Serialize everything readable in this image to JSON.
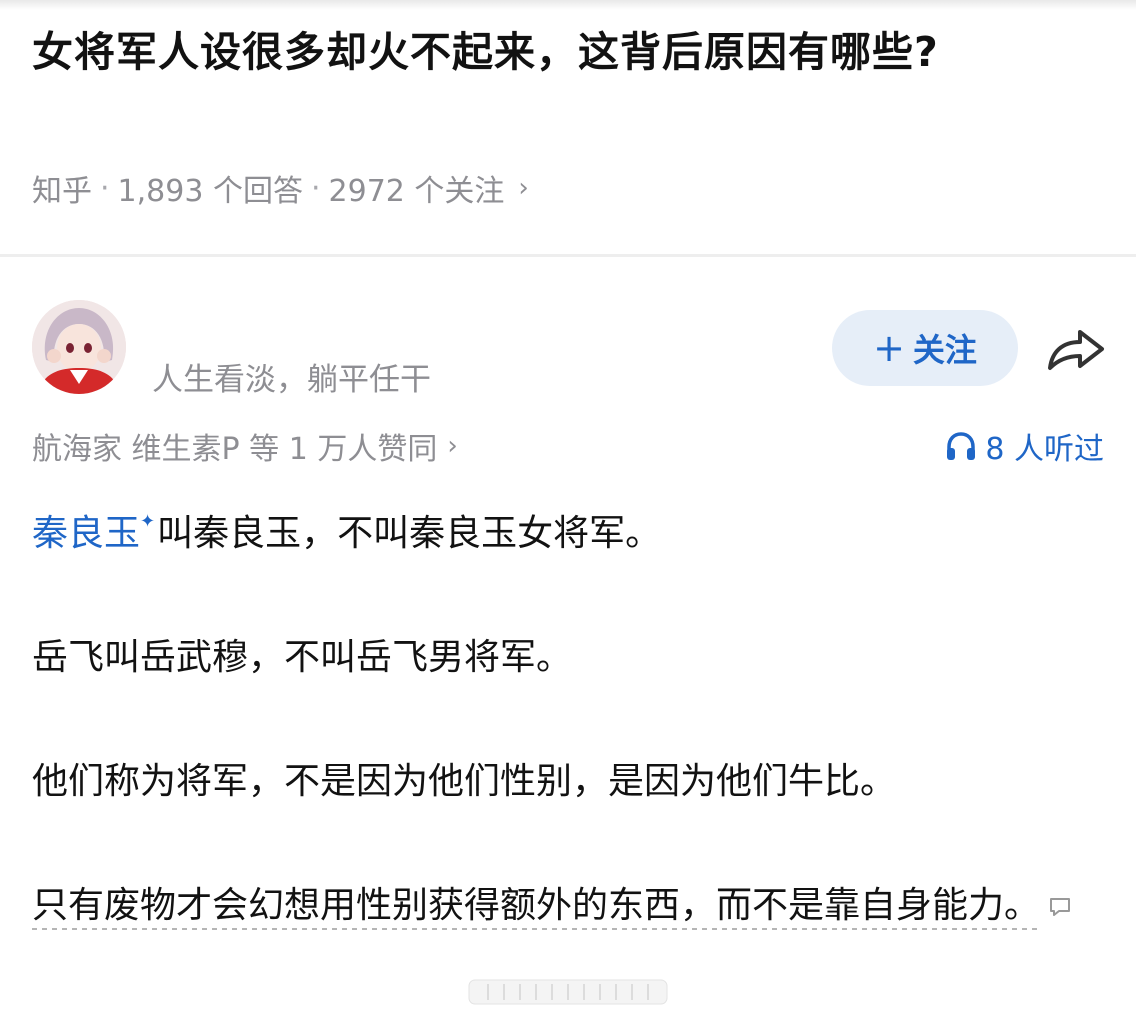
{
  "question": {
    "title": "女将军人设很多却火不起来，这背后原因有哪些?",
    "source": "知乎",
    "answers": "1,893 个回答",
    "followers": "2972 个关注",
    "sep": "·",
    "chevron": "›"
  },
  "author": {
    "avatar_icon": "anime-girl-avatar",
    "signature": "人生看淡，躺平任干",
    "follow_label": "关注",
    "follow_plus": "+",
    "share_icon": "share-arrow-icon"
  },
  "endorse": {
    "text": "航海家 维生素P 等 1 万人赞同",
    "chevron": "›"
  },
  "listen": {
    "icon": "headphones-icon",
    "text": "8 人听过"
  },
  "answer": {
    "entity": "秦良玉",
    "entity_mark": "✦",
    "p1_rest": "叫秦良玉，不叫秦良玉女将军。",
    "p2": "岳飞叫岳武穆，不叫岳飞男将军。",
    "p3": "他们称为将军，不是因为他们性别，是因为他们牛比。",
    "p4": "只有废物才会幻想用性别获得额外的东西，而不是靠自身能力。"
  },
  "colors": {
    "accent": "#1f66c7",
    "muted": "#8e8e93",
    "follow_bg": "#e6eef8"
  }
}
